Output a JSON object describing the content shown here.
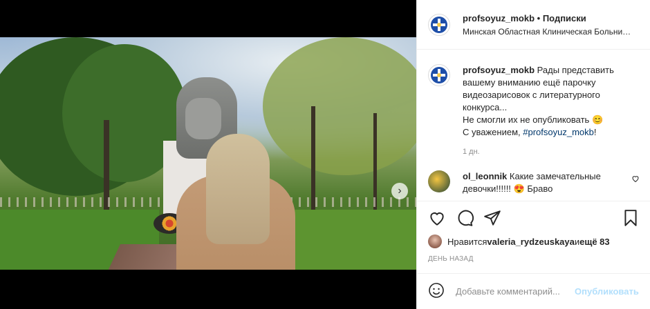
{
  "post": {
    "username": "profsoyuz_mokb",
    "separator": "•",
    "follow_status": "Подписки",
    "location": "Минская Областная Клиническая Больница...",
    "caption": {
      "line1": "Рады представить",
      "line2": "вашему вниманию ещё парочку",
      "line3": "видеозарисовок с литературного",
      "line4": "конкурса...",
      "line5": "Не смогли их не опубликовать 😊",
      "line6_prefix": "С уважением, ",
      "hashtag": "#profsoyuz_mokb",
      "line6_suffix": "!"
    },
    "caption_time": "1 дн.",
    "comment": {
      "username": "ol_leonnik",
      "text_line1": "Какие замечательные",
      "text_line2": "девочки!!!!!! 😍 Браво"
    },
    "likes": {
      "prefix": "Нравится ",
      "user": "valeria_rydzeuskaya",
      "middle": " и ",
      "count": "ещё 83"
    },
    "date": "ДЕНЬ НАЗАД",
    "add_comment_placeholder": "Добавьте комментарий...",
    "publish_label": "Опубликовать"
  },
  "media": {
    "carousel_total": 2,
    "carousel_active": 1
  },
  "colors": {
    "link": "#00376b",
    "muted": "#8e8e8e",
    "publish_disabled": "#b2dffc"
  },
  "icons": {
    "like": "heart-icon",
    "comment": "comment-icon",
    "share": "paper-plane-icon",
    "save": "bookmark-icon",
    "emoji": "smiley-icon",
    "mute": "speaker-muted-icon",
    "next": "chevron-right-icon"
  }
}
